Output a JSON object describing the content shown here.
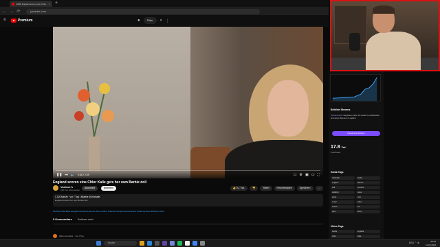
{
  "browser": {
    "tab_title": "[ÜRB] England scoren eine Chlor...",
    "tab_close": "×",
    "new_tab": "+",
    "url": "youtube.com",
    "nav": [
      "←",
      "→",
      "⟳"
    ]
  },
  "youtube": {
    "menu_icon": "≡",
    "logo_text": "Premium",
    "filter_label": "Filter",
    "icons": [
      "search-icon",
      "more-icon"
    ]
  },
  "video": {
    "time": "0:36 / 2:39",
    "progress_fraction": 0.0,
    "title": "England scoren eine Chlor Kalle gets her own Barbie doll",
    "channel": "Vorbeer's",
    "subscribers": "106 Tsd. Abonnenten",
    "subscribed_label": "Abonniert",
    "join_label": "Beitreten",
    "actions": [
      "👍 5,1 Tsd.",
      "👎",
      "Teilen",
      "Herunterladen",
      "Speichern",
      "…"
    ],
    "description_line1": "1.115 Aufrufe · vor 7 Tag · #Barbie #Chlorkalle",
    "description_line2": "England scored her own Barbie doll",
    "hashtags": "#barbie #chlorkalle #england #celebrity #news #shorts #fun #viral #trending #entertainment #celebritynews #fashion #doll",
    "comments_count": "5 Kommentare",
    "sort_label": "Sortieren nach",
    "first_comment": "@kommentator · vor 1 Tag"
  },
  "right_panel": {
    "section_trending": "Beliebte Streams",
    "chat_name": "Vorbeermacht",
    "chat_text": "Vergessen nicht, die Leute zu unterstützen und einen Daumen zu geben!",
    "button_label": "Kanal unterstützen",
    "views_number": "17.8",
    "views_unit": "Tsd.",
    "views_label": "Zuschauer",
    "section_channels": "Kanal-Tags",
    "tags": [
      "chlorkalle",
      "barbie",
      "england",
      "fashion",
      "doll",
      "youtube",
      "celebrity",
      "news",
      "trend",
      "viral",
      "music",
      "video",
      "stream",
      "live",
      "clips",
      "funny"
    ],
    "section_video_tags": "Video-Tags",
    "video_tags": [
      "barbie",
      "england",
      "chlor",
      "kalle",
      "doll",
      "shorts"
    ]
  },
  "taskbar": {
    "search_label": "Suche",
    "clock_time": "20:40",
    "clock_date": "12.03.2024",
    "tray": "DEU ⌃ ⊕"
  }
}
